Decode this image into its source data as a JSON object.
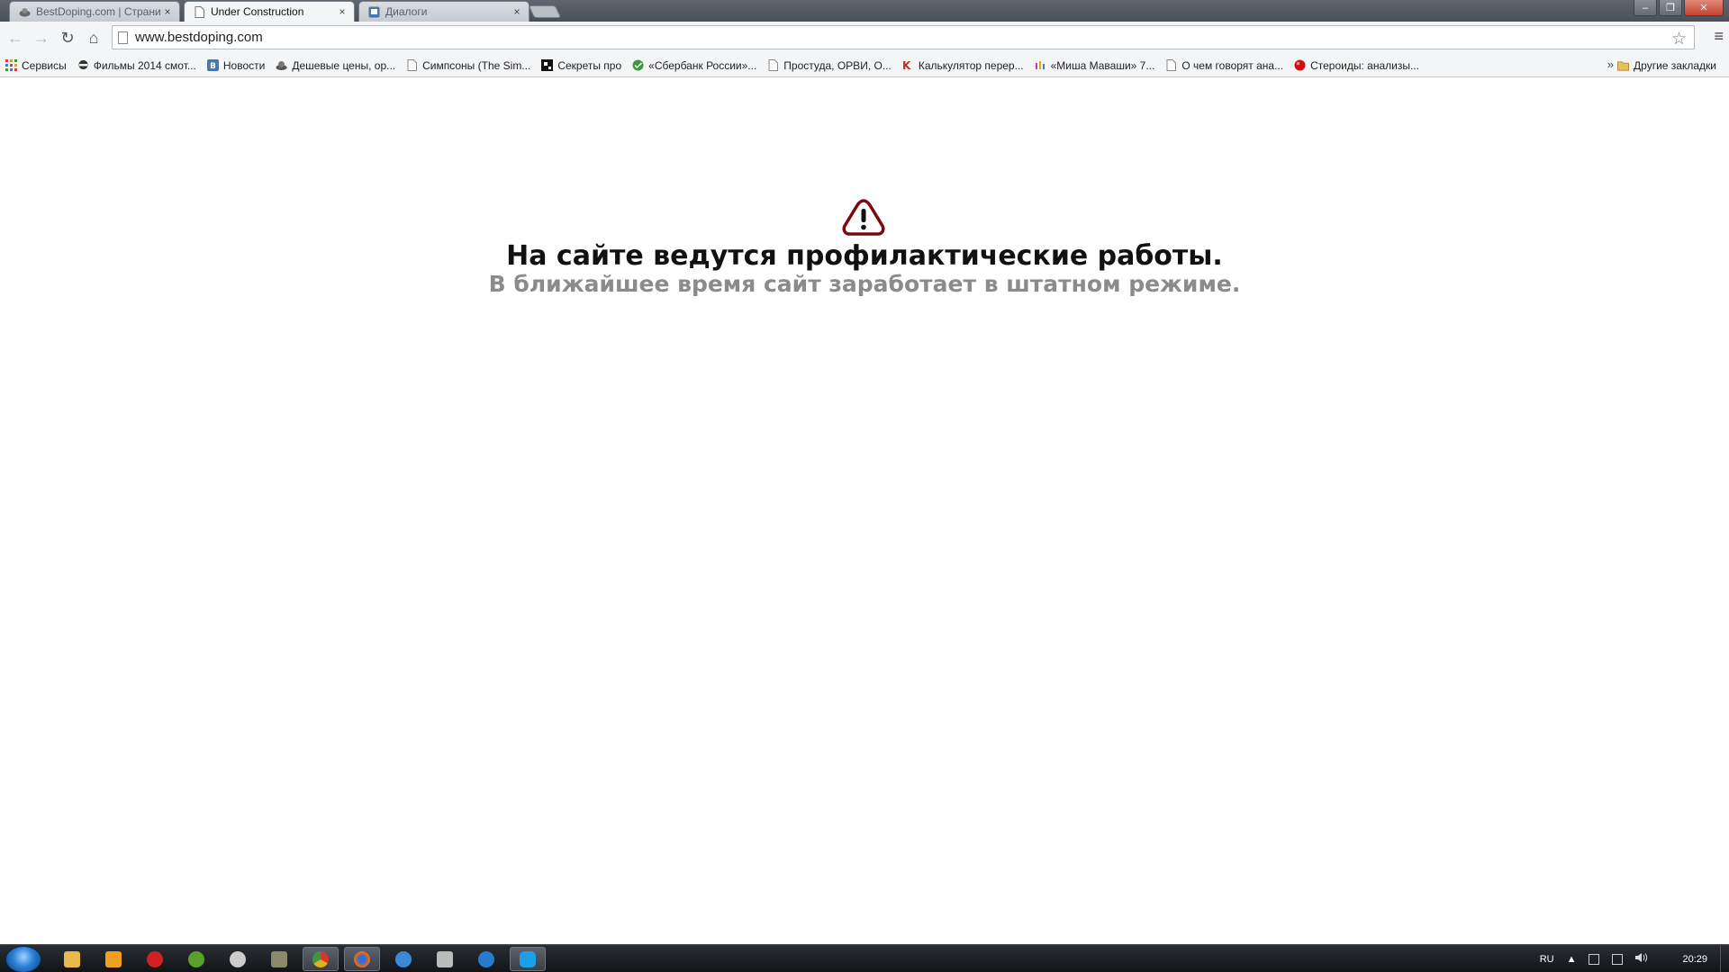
{
  "tabs": [
    {
      "title": "BestDoping.com | Страни",
      "close": "×",
      "active": false
    },
    {
      "title": "Under Construction",
      "close": "×",
      "active": true
    },
    {
      "title": "Диалоги",
      "close": "×",
      "active": false
    }
  ],
  "window_buttons": {
    "minimize": "–",
    "restore": "❐",
    "close": "✕"
  },
  "toolbar": {
    "back": "←",
    "forward": "→",
    "reload": "↻",
    "home": "⌂",
    "url": "www.bestdoping.com",
    "star": "☆",
    "menu": "≡"
  },
  "bookmarks": [
    {
      "label": "Сервисы",
      "icon": "apps-icon",
      "color": "#d04040"
    },
    {
      "label": "Фильмы 2014 смот...",
      "icon": "film-icon",
      "color": "#333333"
    },
    {
      "label": "Новости",
      "icon": "vk-icon",
      "color": "#4a76a8"
    },
    {
      "label": "Дешевые цены, ор...",
      "icon": "cart-icon",
      "color": "#555555"
    },
    {
      "label": "Симпсоны (The Sim...",
      "icon": "page-icon",
      "color": "#888888"
    },
    {
      "label": "Секреты про",
      "icon": "qr-icon",
      "color": "#111111"
    },
    {
      "label": "«Сбербанк России»...",
      "icon": "sberbank-icon",
      "color": "#3a9a3a"
    },
    {
      "label": "Простуда, ОРВИ, О...",
      "icon": "page-icon",
      "color": "#888888"
    },
    {
      "label": "Калькулятор перер...",
      "icon": "k-icon",
      "color": "#c0302a"
    },
    {
      "label": "«Миша Маваши» 7...",
      "icon": "m-icon",
      "color": "#c040c0"
    },
    {
      "label": "О чем говорят ана...",
      "icon": "page-icon",
      "color": "#888888"
    },
    {
      "label": "Стероиды: анализы...",
      "icon": "red-dot-icon",
      "color": "#d01010"
    }
  ],
  "bookmarks_more": "»",
  "bookmarks_other": "Другие закладки",
  "page": {
    "headline": "На сайте ведутся профилактические работы.",
    "subline": "В ближайшее время сайт заработает в штатном режиме.",
    "warning_color": "#7a0a0a"
  },
  "taskbar": {
    "items": [
      {
        "name": "explorer-icon",
        "color": "#e8b84a",
        "open": false
      },
      {
        "name": "media-player-icon",
        "color": "#f0a020",
        "open": false
      },
      {
        "name": "app-red-icon",
        "color": "#d02020",
        "open": false
      },
      {
        "name": "utorrent-icon",
        "color": "#5aa02a",
        "open": false
      },
      {
        "name": "network-icon",
        "color": "#cccccc",
        "open": false
      },
      {
        "name": "game-icon",
        "color": "#8a8a6a",
        "open": false
      },
      {
        "name": "chrome-icon",
        "color": "#e0b020",
        "open": true
      },
      {
        "name": "firefox-icon",
        "color": "#e06a20",
        "open": true
      },
      {
        "name": "ie-blue-icon",
        "color": "#3a8ad8",
        "open": false
      },
      {
        "name": "tool-icon",
        "color": "#bbbbbb",
        "open": false
      },
      {
        "name": "ie-icon",
        "color": "#2a7ad0",
        "open": false
      },
      {
        "name": "skype-icon",
        "color": "#1aa0e8",
        "open": true
      }
    ],
    "language": "RU",
    "tray_arrow": "▲",
    "time": "20:29"
  }
}
